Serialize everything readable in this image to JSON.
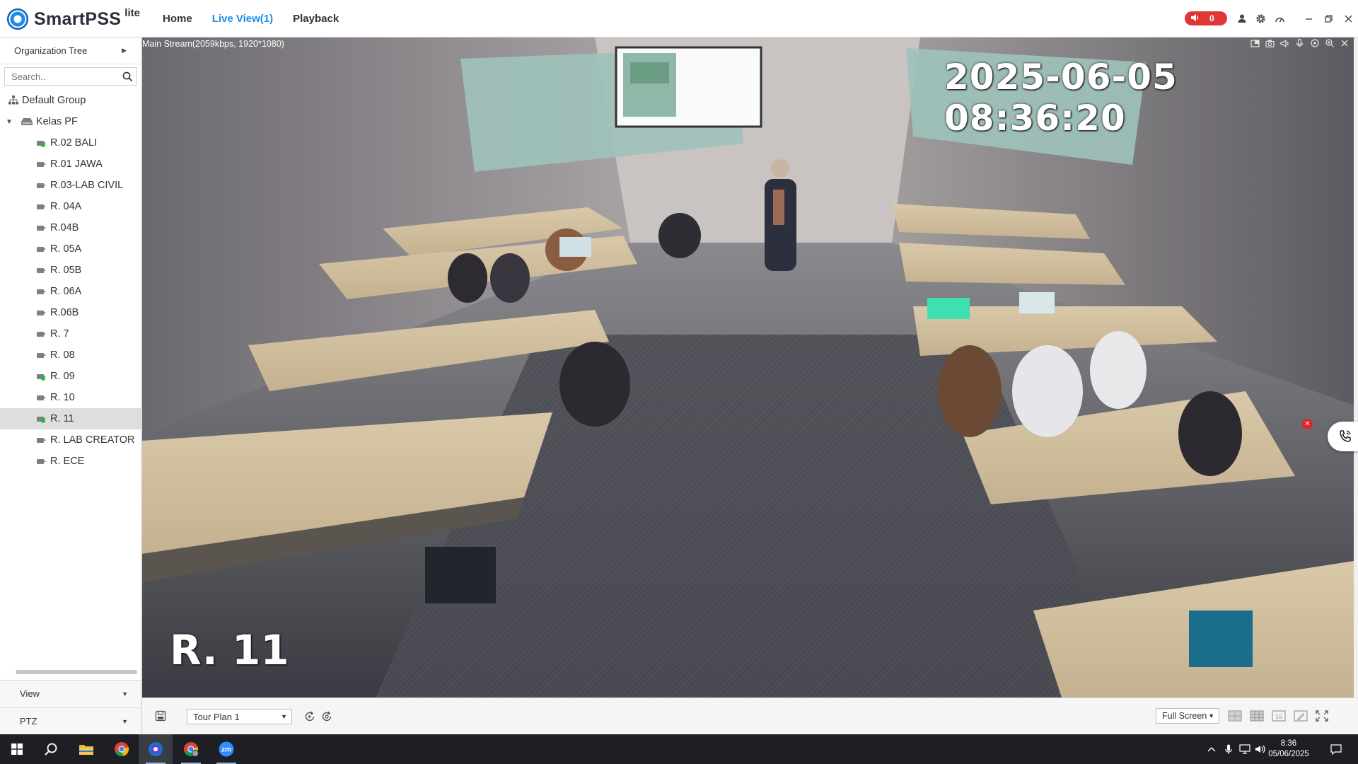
{
  "app": {
    "logo_text": "SmartPSS",
    "logo_sup": "lite",
    "nav": [
      {
        "label": "Home"
      },
      {
        "label": "Live View(1)"
      },
      {
        "label": "Playback"
      }
    ],
    "alarm_count": "0",
    "accent_color": "#1a8ee8",
    "alarm_color": "#e03636"
  },
  "sidebar": {
    "org_tree_label": "Organization Tree",
    "search_placeholder": "Search..",
    "default_group": "Default Group",
    "group_name": "Kelas PF",
    "devices": [
      {
        "label": "R.02 BALI",
        "online": true
      },
      {
        "label": "R.01 JAWA",
        "online": false
      },
      {
        "label": "R.03-LAB CIVIL",
        "online": false
      },
      {
        "label": "R. 04A",
        "online": false
      },
      {
        "label": "R.04B",
        "online": false
      },
      {
        "label": "R. 05A",
        "online": false
      },
      {
        "label": "R. 05B",
        "online": false
      },
      {
        "label": "R. 06A",
        "online": false
      },
      {
        "label": "R.06B",
        "online": false
      },
      {
        "label": "R. 7",
        "online": false
      },
      {
        "label": "R. 08",
        "online": false
      },
      {
        "label": "R. 09",
        "online": true
      },
      {
        "label": "R. 10",
        "online": false
      },
      {
        "label": "R. 11",
        "online": true,
        "selected": true
      },
      {
        "label": "R. LAB CREATOR",
        "online": false
      },
      {
        "label": "R. ECE",
        "online": false
      }
    ],
    "view_label": "View",
    "ptz_label": "PTZ"
  },
  "video": {
    "stream_info": "Main Stream(2059kbps, 1920*1080)",
    "osd_timestamp": "2025-06-05 08:36:20",
    "osd_channel": "R. 11"
  },
  "bottom": {
    "tour_plan": "Tour Plan 1",
    "full_screen": "Full Screen",
    "layout_16_label": "16"
  },
  "taskbar": {
    "time": "8:36",
    "date": "05/06/2025"
  }
}
